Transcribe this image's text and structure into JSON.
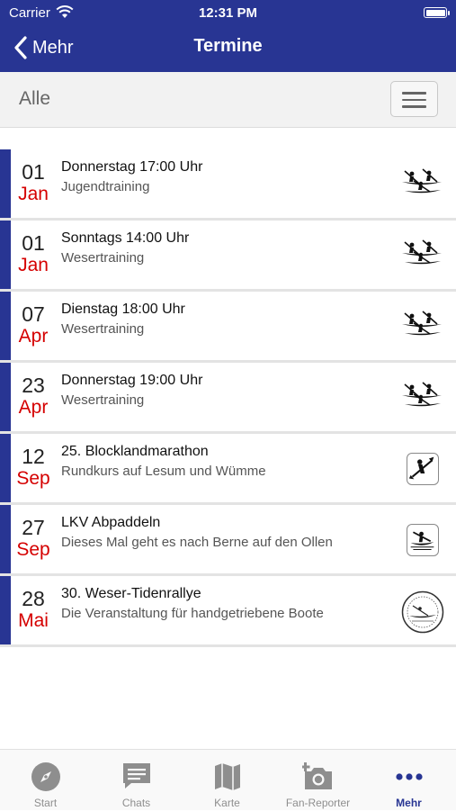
{
  "status_bar": {
    "carrier": "Carrier",
    "time": "12:31 PM",
    "battery_level": 1.0
  },
  "nav": {
    "back_label": "Mehr",
    "title": "Termine"
  },
  "filter": {
    "label": "Alle",
    "menu_icon": "hamburger-menu-icon"
  },
  "colors": {
    "brand": "#283593",
    "month": "#d50000",
    "tab_inactive": "#8e8e8e"
  },
  "events": [
    {
      "day": "01",
      "month": "Jan",
      "title": "Donnerstag 17:00 Uhr",
      "subtitle": "Jugendtraining",
      "icon": "kayak-paddlers-icon"
    },
    {
      "day": "01",
      "month": "Jan",
      "title": "Sonntags 14:00 Uhr",
      "subtitle": "Wesertraining",
      "icon": "kayak-paddlers-icon"
    },
    {
      "day": "07",
      "month": "Apr",
      "title": "Dienstag 18:00 Uhr",
      "subtitle": "Wesertraining",
      "icon": "kayak-paddlers-icon"
    },
    {
      "day": "23",
      "month": "Apr",
      "title": "Donnerstag 19:00 Uhr",
      "subtitle": "Wesertraining",
      "icon": "kayak-paddlers-icon"
    },
    {
      "day": "12",
      "month": "Sep",
      "title": "25. Blocklandmarathon",
      "subtitle": "Rundkurs auf Lesum und Wümme",
      "icon": "paddler-badge-icon"
    },
    {
      "day": "27",
      "month": "Sep",
      "title": "LKV Abpaddeln",
      "subtitle": "Dieses Mal geht es nach Berne auf den Ollen",
      "icon": "kayak-badge-icon"
    },
    {
      "day": "28",
      "month": "Mai",
      "title": "30. Weser-Tidenrallye",
      "subtitle": "Die Veranstaltung für handgetriebene Boote",
      "icon": "rally-seal-icon"
    }
  ],
  "tabs": [
    {
      "label": "Start",
      "icon": "compass-icon",
      "active": false
    },
    {
      "label": "Chats",
      "icon": "chat-icon",
      "active": false
    },
    {
      "label": "Karte",
      "icon": "map-icon",
      "active": false
    },
    {
      "label": "Fan-Reporter",
      "icon": "camera-plus-icon",
      "active": false
    },
    {
      "label": "Mehr",
      "icon": "more-dots-icon",
      "active": true
    }
  ]
}
